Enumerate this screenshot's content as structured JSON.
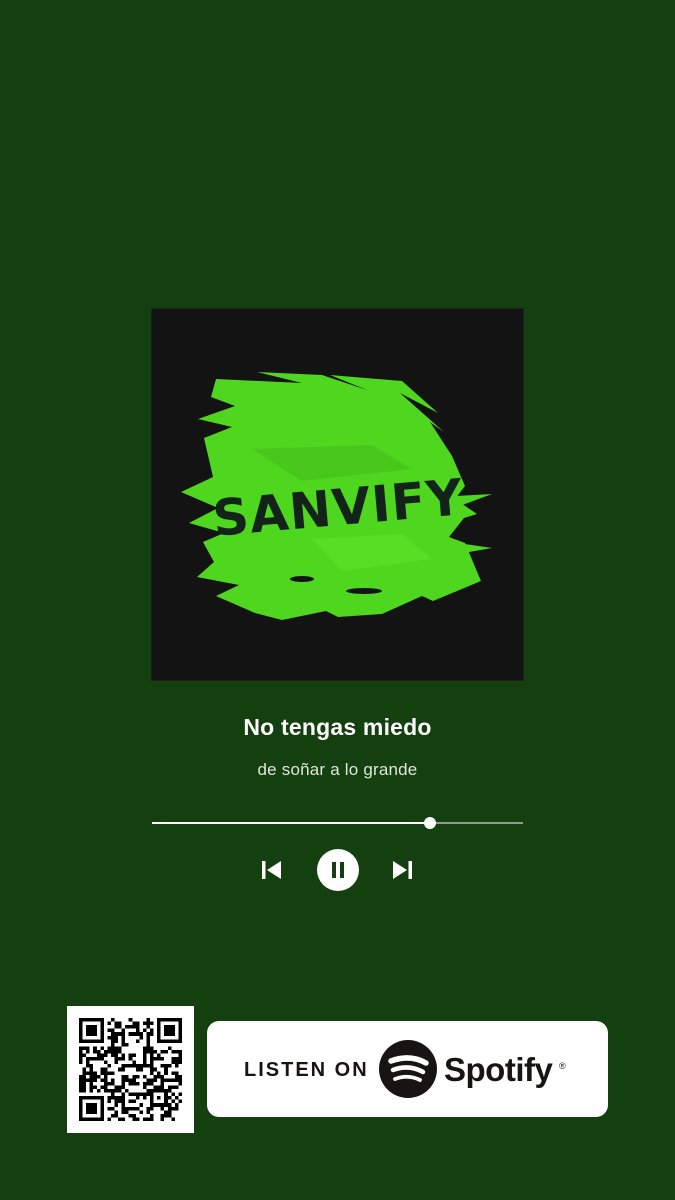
{
  "album": {
    "brand_text": "SANVIFY",
    "background_color": "#131313",
    "splash_color": "#4fd61e"
  },
  "track": {
    "title": "No tengas miedo",
    "subtitle": "de soñar a lo grande"
  },
  "player": {
    "progress": 0.75,
    "controls": {
      "previous_icon": "skip-previous-icon",
      "pause_icon": "pause-icon",
      "next_icon": "skip-next-icon"
    }
  },
  "listen_button": {
    "label": "LISTEN ON",
    "brand": "Spotify",
    "trademark": "®",
    "logo_icon": "spotify-logo-icon"
  },
  "qr": {
    "icon": "qr-code-icon"
  },
  "colors": {
    "background": "#143f0e",
    "text_primary": "#ffffff",
    "text_secondary": "#dfe6dc"
  }
}
